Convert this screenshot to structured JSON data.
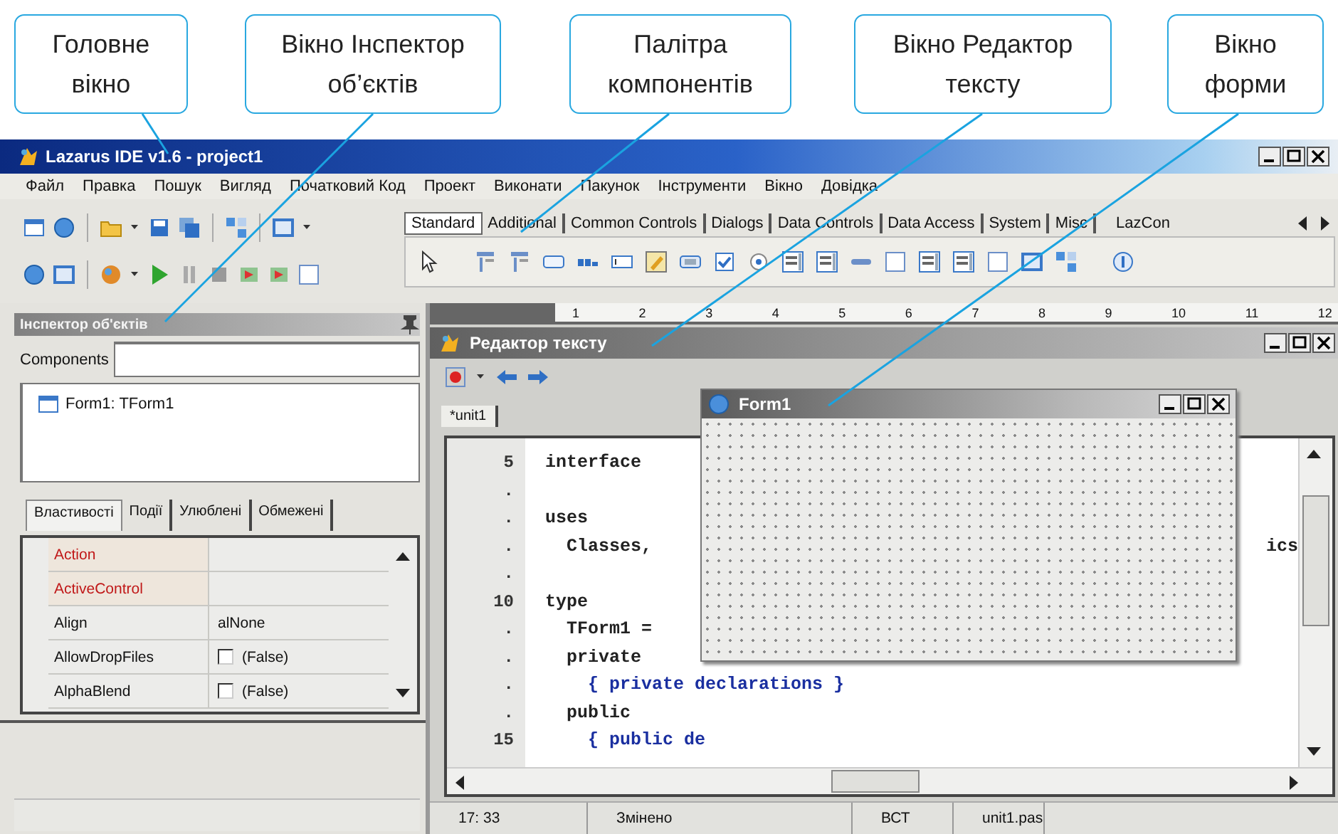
{
  "callouts": [
    {
      "text": "Головне\nвікно"
    },
    {
      "text": "Вікно Інспектор\nоб’єктів"
    },
    {
      "text": "Палітра\nкомпонентів"
    },
    {
      "text": "Вікно Редактор\nтексту"
    },
    {
      "text": "Вікно\nформи"
    }
  ],
  "main_window": {
    "title": "Lazarus IDE v1.6 - project1",
    "menu": [
      "Файл",
      "Правка",
      "Пошук",
      "Вигляд",
      "Початковий Код",
      "Проект",
      "Виконати",
      "Пакунок",
      "Інструменти",
      "Вікно",
      "Довідка"
    ],
    "palette": {
      "tabs": [
        {
          "label": "Standard",
          "selected": true
        },
        {
          "label": "Additional",
          "selected": false
        },
        {
          "label": "Common Controls",
          "selected": false
        },
        {
          "label": "Dialogs",
          "selected": false
        },
        {
          "label": "Data Controls",
          "selected": false
        },
        {
          "label": "Data Access",
          "selected": false
        },
        {
          "label": "System",
          "selected": false
        },
        {
          "label": "Misc",
          "selected": false
        },
        {
          "label": "LazCon",
          "selected": false
        }
      ]
    }
  },
  "object_inspector": {
    "title": "Інспектор об'єктів",
    "components_label": "Components",
    "tree": [
      {
        "label": "Form1: TForm1"
      }
    ],
    "tabs": [
      {
        "label": "Властивості",
        "selected": true
      },
      {
        "label": "Події",
        "selected": false
      },
      {
        "label": "Улюблені",
        "selected": false
      },
      {
        "label": "Обмежені",
        "selected": false
      }
    ],
    "properties": [
      {
        "name": "Action",
        "kind": "text",
        "highlighted": true
      },
      {
        "name": "ActiveControl",
        "kind": "text",
        "highlighted": true
      },
      {
        "name": "Align",
        "kind": "text",
        "value": "alNone",
        "highlighted": false
      },
      {
        "name": "AllowDropFiles",
        "kind": "checkbox",
        "value": "(False)",
        "checked": false,
        "highlighted": false
      },
      {
        "name": "AlphaBlend",
        "kind": "checkbox",
        "value": "(False)",
        "checked": false,
        "highlighted": false
      }
    ]
  },
  "ruler": {
    "labels": [
      "1",
      "2",
      "3",
      "4",
      "5",
      "6",
      "7",
      "8",
      "9",
      "10",
      "11",
      "12"
    ]
  },
  "source_editor": {
    "title": "Редактор тексту",
    "tabs": [
      {
        "label": "*unit1",
        "selected": true
      }
    ],
    "lines": [
      {
        "number": "5",
        "text": "interface",
        "kind": "code"
      },
      {
        "number": ".",
        "kind": "code"
      },
      {
        "number": ".",
        "text": "uses",
        "kind": "code"
      },
      {
        "number": ".",
        "text": "  Classes,",
        "tail": "ics",
        "kind": "code"
      },
      {
        "number": ".",
        "kind": "code"
      },
      {
        "number": "10",
        "text": "type",
        "kind": "code"
      },
      {
        "number": ".",
        "text": "  TForm1 =",
        "kind": "code"
      },
      {
        "number": ".",
        "text": "  private",
        "kind": "code"
      },
      {
        "number": ".",
        "text": "    { private declarations }",
        "kind": "comment"
      },
      {
        "number": ".",
        "text": "  public",
        "kind": "code"
      },
      {
        "number": "15",
        "text": "    { public de",
        "kind": "comment"
      }
    ],
    "status": [
      "17: 33",
      "Змінено",
      "ВСТ",
      "unit1.pas"
    ]
  },
  "form_window": {
    "title": "Form1"
  }
}
